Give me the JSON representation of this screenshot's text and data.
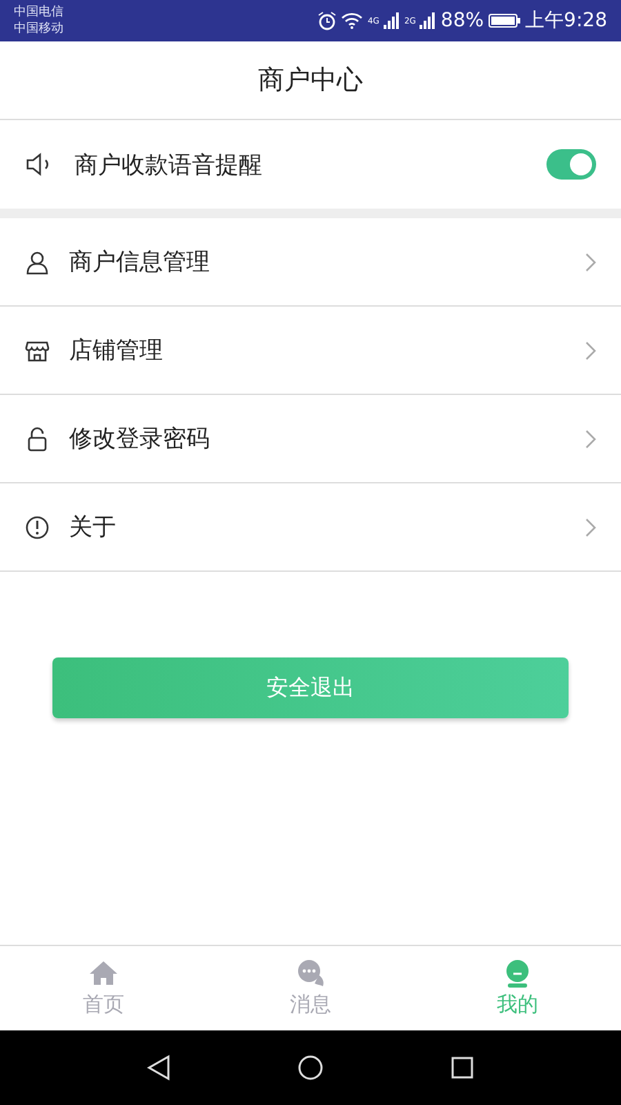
{
  "status_bar": {
    "carriers": [
      "中国电信",
      "中国移动"
    ],
    "network_1": "4G",
    "network_2": "2G",
    "battery": "88%",
    "time": "上午9:28"
  },
  "header": {
    "title": "商户中心"
  },
  "voice_alert": {
    "label": "商户收款语音提醒",
    "on": true
  },
  "menu": [
    {
      "kind": "user",
      "label": "商户信息管理"
    },
    {
      "kind": "store",
      "label": "店铺管理"
    },
    {
      "kind": "lock",
      "label": "修改登录密码"
    },
    {
      "kind": "info",
      "label": "关于"
    }
  ],
  "logout_button": "安全退出",
  "tabs": [
    {
      "kind": "home",
      "label": "首页",
      "selected": false
    },
    {
      "kind": "chat",
      "label": "消息",
      "selected": false
    },
    {
      "kind": "me",
      "label": "我的",
      "selected": true
    }
  ]
}
